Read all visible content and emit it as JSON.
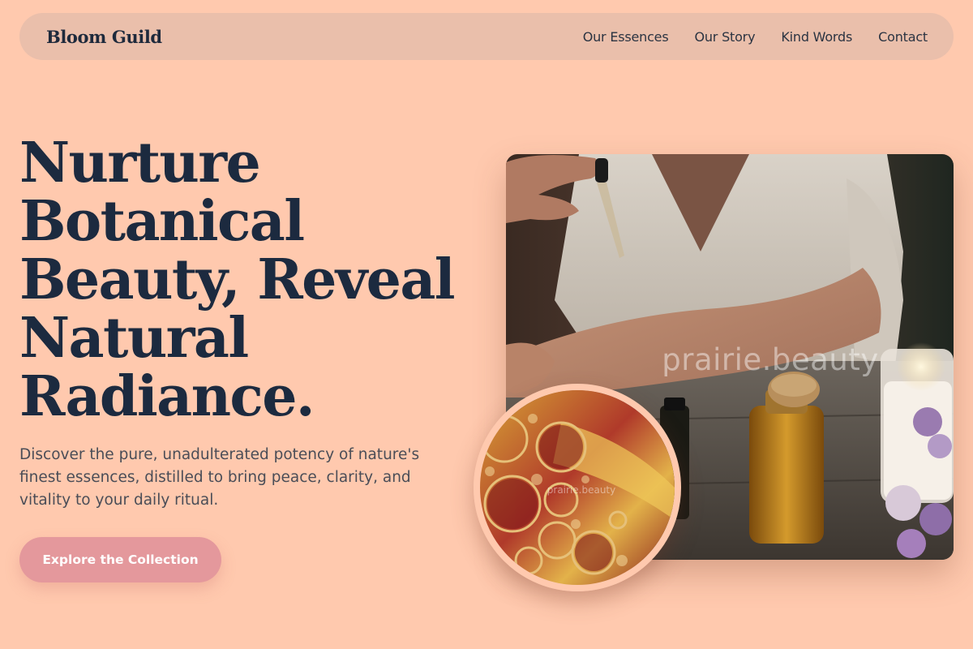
{
  "nav": {
    "brand": "Bloom Guild",
    "links": [
      "Our Essences",
      "Our Story",
      "Kind Words",
      "Contact"
    ]
  },
  "hero": {
    "headline_lines": [
      "Nurture",
      "Botanical",
      "Beauty, Reveal",
      "Natural",
      "Radiance."
    ],
    "subtext": "Discover the pure, unadulterated potency of nature's finest essences, distilled to bring peace, clarity, and vitality to your daily ritual.",
    "cta_label": "Explore the Collection"
  },
  "images": {
    "main_watermark": "prairie.beauty",
    "inset_watermark": "prairie.beauty"
  },
  "colors": {
    "background": "#ffc9ae",
    "nav_background": "#eabfab",
    "heading": "#1c2a3f",
    "cta": "#e4989c"
  }
}
